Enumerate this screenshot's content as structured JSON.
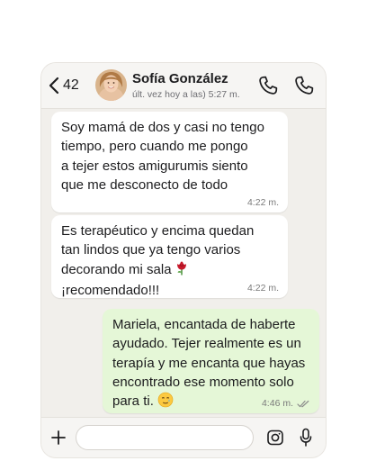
{
  "header": {
    "back_count": "42",
    "contact_name": "Sofía González",
    "contact_status": "últ. vez hoy a las) 5:27 m."
  },
  "messages": [
    {
      "direction": "incoming",
      "text": "Soy mamá de dos y casi no tengo\ntiempo, pero cuando me pongo\na tejer estos amigurumis siento\nque me desconecto de todo",
      "time": "4:22 m."
    },
    {
      "direction": "incoming",
      "text_lines": [
        "Es terapéutico y encima quedan",
        "tan lindos que ya tengo varios",
        "decorando mi sala"
      ],
      "last_line": "¡recomendado!!!",
      "emoji": "rose-emoji",
      "time": "4:22 m."
    },
    {
      "direction": "outgoing",
      "text_lines": [
        "Mariela, encantada de haberte",
        "ayudado. Tejer realmente es un",
        "terapía y me encanta que hayas",
        "encontrado ese momento solo"
      ],
      "last_line": "para ti.",
      "emoji": "smiling-face-with-tear-emoji",
      "time": "4:46 m.",
      "status_icon": "double-check-read-icon"
    }
  ],
  "composer": {
    "placeholder": ""
  },
  "icons": {
    "back": "chevron-left-icon",
    "call_1": "phone-icon",
    "call_2": "phone-icon",
    "add": "plus-icon",
    "camera": "camera-icon",
    "mic": "microphone-icon"
  },
  "colors": {
    "chat_background": "#f1efeb",
    "outgoing_bubble": "#e5f7d7",
    "incoming_bubble": "#ffffff",
    "read_receipt": "#8a8a8a"
  }
}
